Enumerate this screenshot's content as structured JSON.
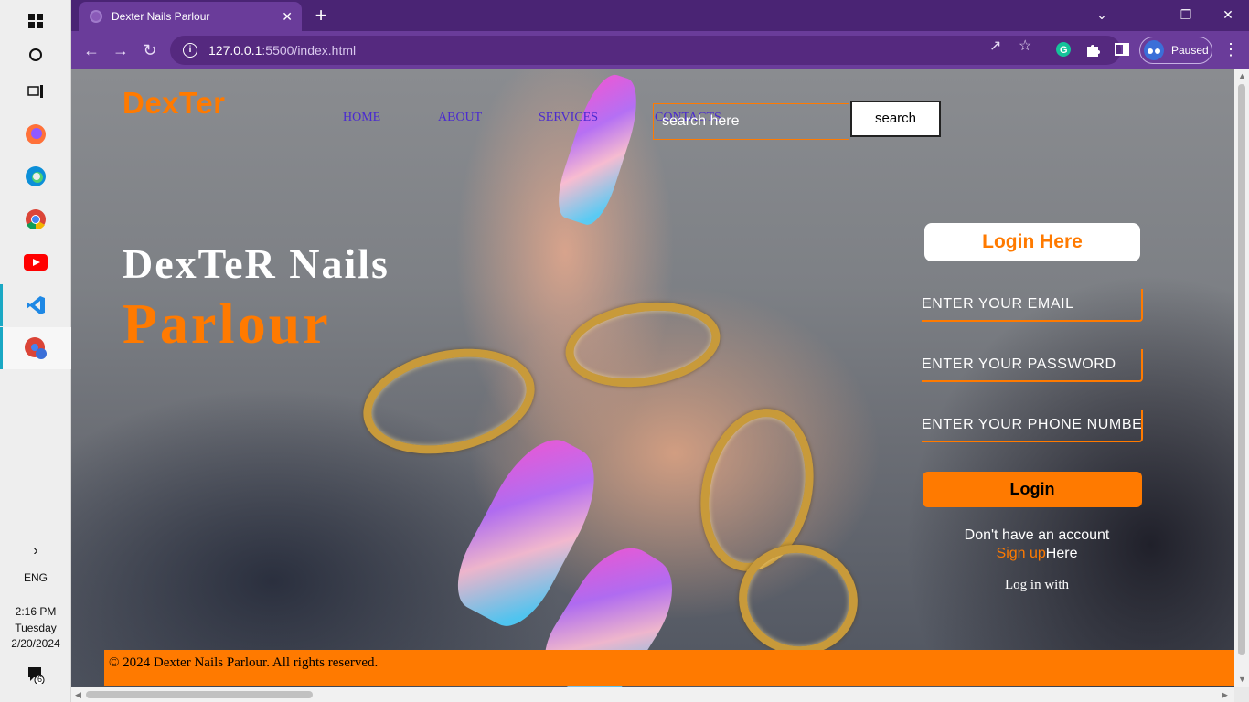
{
  "taskbar": {
    "time": "2:16 PM",
    "day": "Tuesday",
    "date": "2/20/2024",
    "language": "ENG",
    "notifications_count": "6",
    "apps": [
      "windows-start-icon",
      "cortana-icon",
      "task-view-icon",
      "firefox-icon",
      "edge-icon",
      "chrome-icon",
      "youtube-icon",
      "vscode-icon",
      "chrome-profile-icon"
    ]
  },
  "browser": {
    "tab_title": "Dexter Nails Parlour",
    "url_host": "127.0.0.1",
    "url_path": ":5500/index.html",
    "profile_label": "Paused",
    "accent_color": "#6a3c9a"
  },
  "site": {
    "logo": "DexTer",
    "nav": [
      "HOME",
      "ABOUT",
      "SERVICES",
      "CONTACTS"
    ],
    "search_placeholder": "search here",
    "search_button": "search",
    "hero_title": "DexTeR Nails",
    "hero_subtitle": "Parlour",
    "accent_color": "#ff7a00"
  },
  "login": {
    "heading": "Login Here",
    "email_placeholder": "ENTER YOUR EMAIL",
    "password_placeholder": "ENTER YOUR PASSWORD",
    "phone_placeholder": "ENTER YOUR PHONE NUMBER",
    "button": "Login",
    "no_account": "Don't have an account",
    "signup_link": "Sign up",
    "signup_suffix": "Here",
    "login_with": "Log in with"
  },
  "footer": {
    "text": "© 2024 Dexter Nails Parlour. All rights reserved."
  }
}
